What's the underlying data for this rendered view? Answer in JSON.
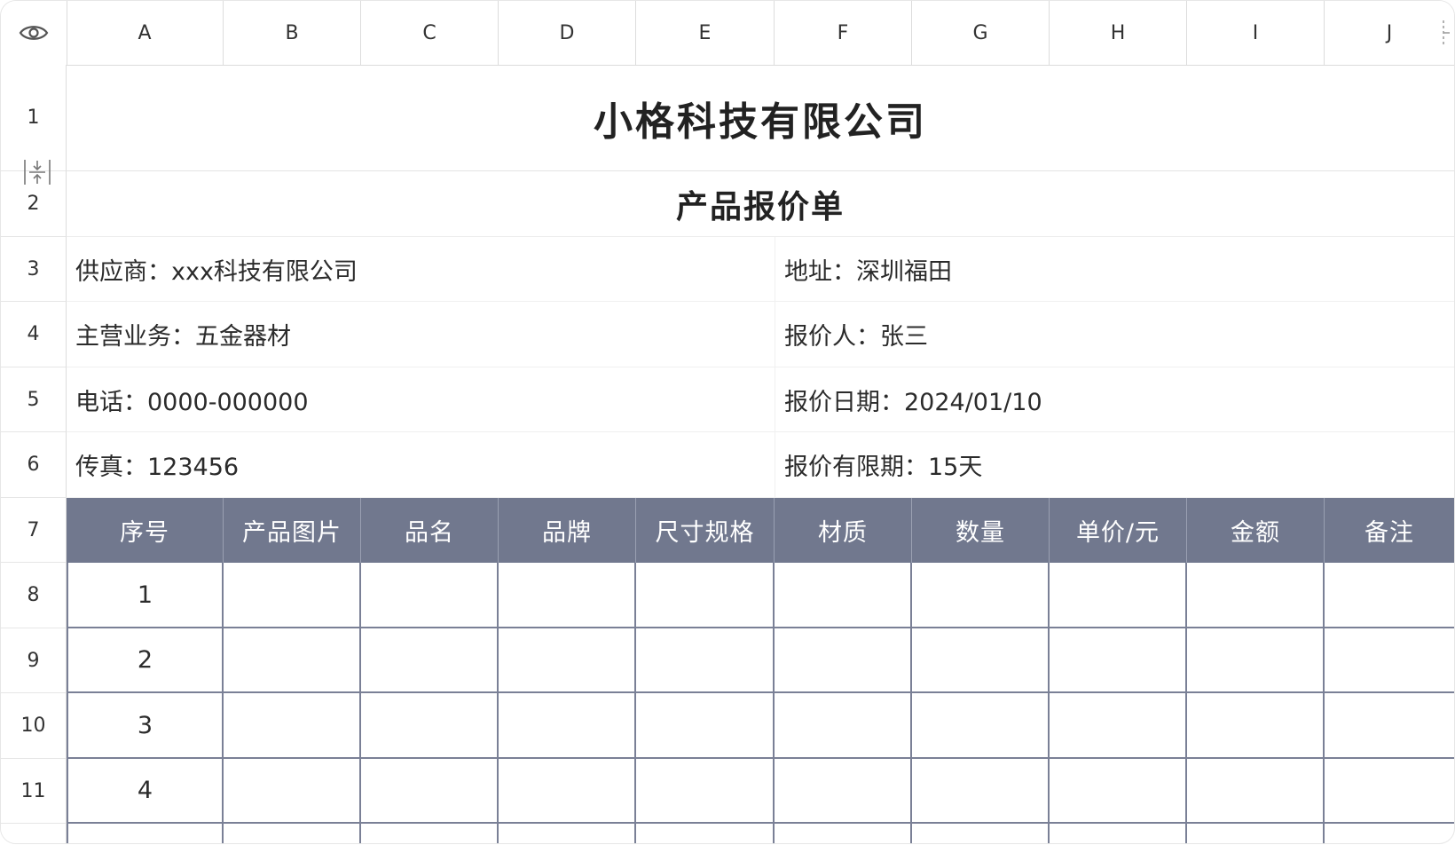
{
  "columns": [
    "A",
    "B",
    "C",
    "D",
    "E",
    "F",
    "G",
    "H",
    "I",
    "J"
  ],
  "rows": [
    "1",
    "2",
    "3",
    "4",
    "5",
    "6",
    "7",
    "8",
    "9",
    "10",
    "11"
  ],
  "title": "小格科技有限公司",
  "subtitle": "产品报价单",
  "info": {
    "supplier": "供应商：xxx科技有限公司",
    "address": "地址：深圳福田",
    "business": "主营业务：五金器材",
    "quoter": "报价人：张三",
    "phone": "电话：0000-000000",
    "quote_date": "报价日期：2024/01/10",
    "fax": "传真：123456",
    "validity": "报价有限期：15天"
  },
  "table": {
    "headers": [
      "序号",
      "产品图片",
      "品名",
      "品牌",
      "尺寸规格",
      "材质",
      "数量",
      "单价/元",
      "金额",
      "备注"
    ],
    "rows": [
      [
        "1",
        "",
        "",
        "",
        "",
        "",
        "",
        "",
        "",
        ""
      ],
      [
        "2",
        "",
        "",
        "",
        "",
        "",
        "",
        "",
        "",
        ""
      ],
      [
        "3",
        "",
        "",
        "",
        "",
        "",
        "",
        "",
        "",
        ""
      ],
      [
        "4",
        "",
        "",
        "",
        "",
        "",
        "",
        "",
        "",
        ""
      ]
    ]
  },
  "colors": {
    "header_bg": "#71788e",
    "header_text": "#ffffff",
    "grid_line": "#7a8096"
  },
  "icons": {
    "visibility": "eye-icon",
    "row_resize": "row-resize-icon",
    "col_resize": "column-resize-icon"
  }
}
